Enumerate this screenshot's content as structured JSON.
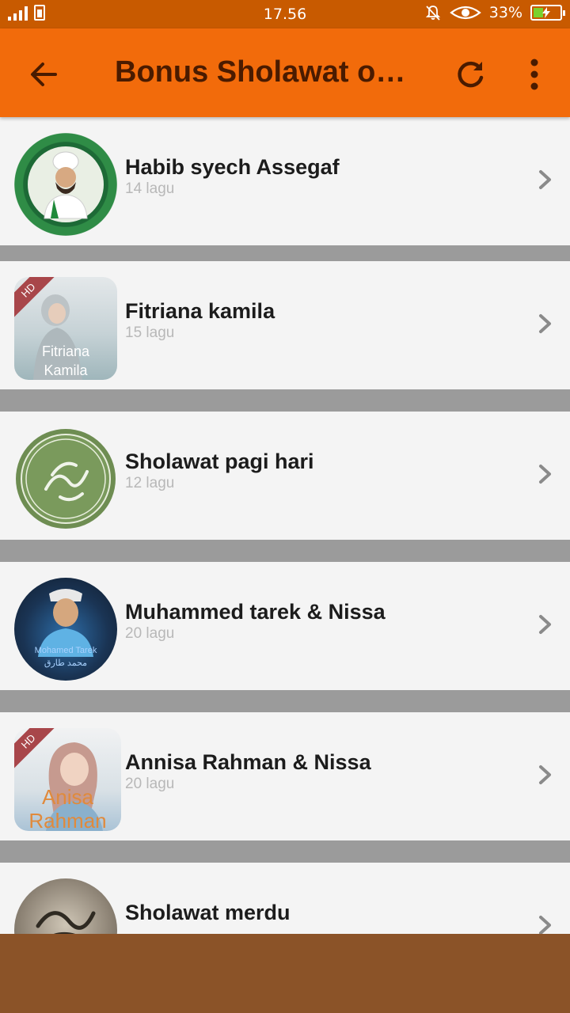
{
  "status_bar": {
    "time": "17.56",
    "battery_percent": "33%",
    "battery_level": 0.33,
    "icons": [
      "signal-icon",
      "battery-saver-icon",
      "mute-icon",
      "eye-comfort-icon",
      "battery-icon"
    ]
  },
  "app_bar": {
    "title": "Bonus Sholawat onl…",
    "back_icon": "back-arrow-icon",
    "refresh_icon": "refresh-icon",
    "more_icon": "more-vertical-icon",
    "color": "#f26b0b"
  },
  "list": {
    "items": [
      {
        "name": "Habib syech Assegaf",
        "count": "14 lagu",
        "thumb": "habib-syech-thumbnail",
        "hd": ""
      },
      {
        "name": "Fitriana kamila",
        "count": "15 lagu",
        "thumb": "fitriana-kamila-thumbnail",
        "hd": "HD",
        "overlay_line1": "Fitriana",
        "overlay_line2": "Kamila"
      },
      {
        "name": "Sholawat pagi hari",
        "count": "12 lagu",
        "thumb": "calligraphy-seal-thumbnail",
        "hd": ""
      },
      {
        "name": "Muhammed tarek & Nissa",
        "count": "20 lagu",
        "thumb": "mohamed-tarek-thumbnail",
        "hd": "",
        "overlay_line1": "Mohamed Tarek",
        "overlay_line2": "محمد طارق"
      },
      {
        "name": "Annisa Rahman & Nissa",
        "count": "20 lagu",
        "thumb": "annisa-rahman-thumbnail",
        "hd": "HD",
        "overlay_line1": "Anisa",
        "overlay_line2": "Rahman"
      },
      {
        "name": "Sholawat merdu",
        "count": "",
        "thumb": "calligraphy-thumbnail",
        "hd": ""
      }
    ]
  },
  "colors": {
    "status_bar": "#c85a00",
    "divider": "#9b9b9b",
    "bottom_bar": "#8b5328"
  }
}
